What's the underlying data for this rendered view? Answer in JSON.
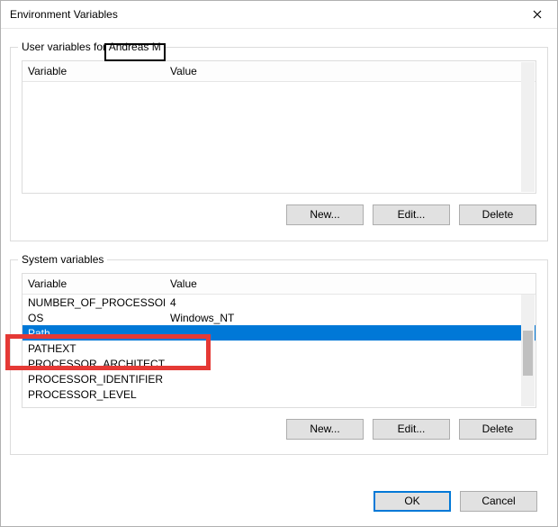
{
  "window": {
    "title": "Environment Variables"
  },
  "user_section": {
    "label_prefix": "User variables for",
    "username": "Andreas M",
    "columns": {
      "variable": "Variable",
      "value": "Value"
    },
    "rows": []
  },
  "system_section": {
    "label": "System variables",
    "columns": {
      "variable": "Variable",
      "value": "Value"
    },
    "rows": [
      {
        "variable": "NUMBER_OF_PROCESSORS",
        "value": "4"
      },
      {
        "variable": "OS",
        "value": "Windows_NT"
      },
      {
        "variable": "Path",
        "value": "",
        "selected": true
      },
      {
        "variable": "PATHEXT",
        "value": ""
      },
      {
        "variable": "PROCESSOR_ARCHITECTURE",
        "value": ""
      },
      {
        "variable": "PROCESSOR_IDENTIFIER",
        "value": ""
      },
      {
        "variable": "PROCESSOR_LEVEL",
        "value": ""
      }
    ]
  },
  "buttons": {
    "new": "New...",
    "edit": "Edit...",
    "delete": "Delete",
    "ok": "OK",
    "cancel": "Cancel"
  },
  "annotations": {
    "highlighted_user": "Andreas M",
    "highlighted_system_variable": "Path"
  }
}
